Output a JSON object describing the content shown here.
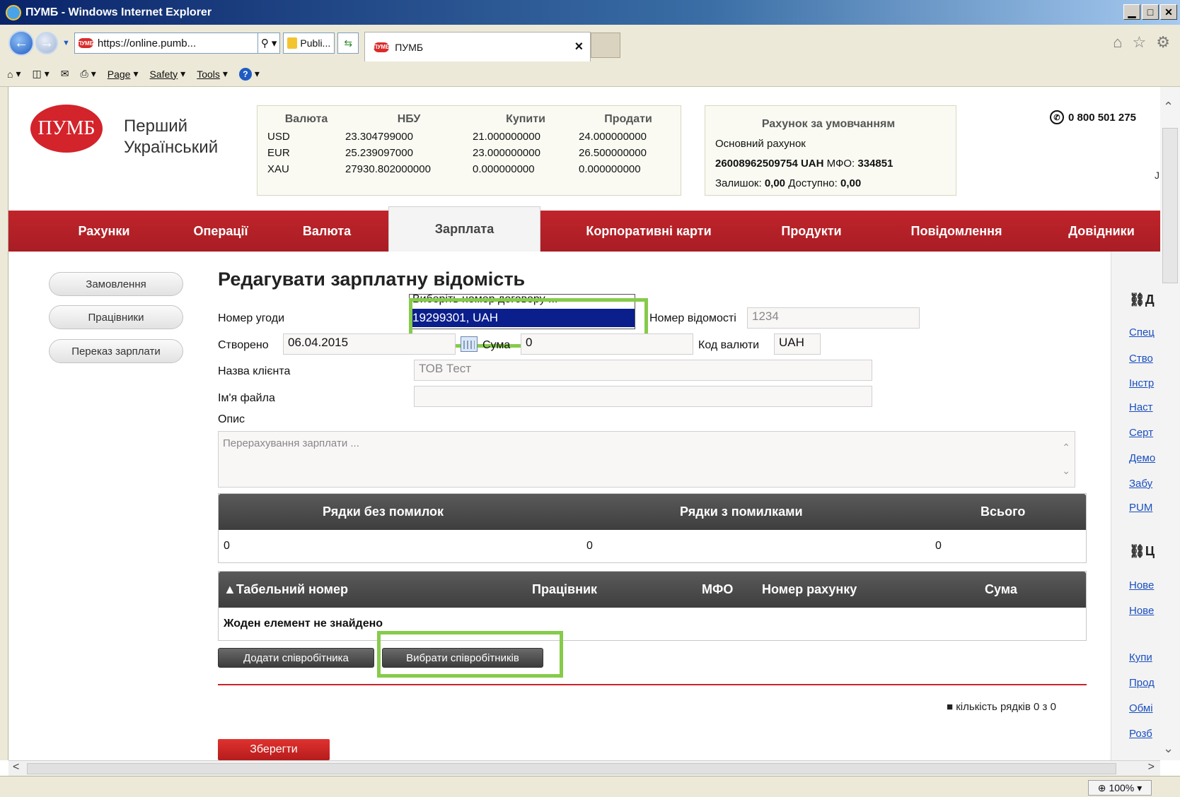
{
  "browser": {
    "window_title": "ПУМБ - Windows Internet Explorer",
    "url": "https://online.pumb...",
    "security_label": "Publi...",
    "tab_title": "ПУМБ",
    "favicon_text": "ПУМБ",
    "menu": {
      "page": "Page",
      "safety": "Safety",
      "tools": "Tools"
    },
    "zoom": "100%"
  },
  "header": {
    "logo_text": "ПУМБ",
    "bank_name_line1": "Перший",
    "bank_name_line2": "Український",
    "phone": "0 800 501 275",
    "stray_char": "J"
  },
  "rates": {
    "headers": [
      "Валюта",
      "НБУ",
      "Купити",
      "Продати"
    ],
    "rows": [
      [
        "USD",
        "23.304799000",
        "21.000000000",
        "24.000000000"
      ],
      [
        "EUR",
        "25.239097000",
        "23.000000000",
        "26.500000000"
      ],
      [
        "XAU",
        "27930.802000000",
        "0.000000000",
        "0.000000000"
      ]
    ]
  },
  "default_account": {
    "title": "Рахунок за умовчанням",
    "name": "Основний рахунок",
    "number": "26008962509754 UAH",
    "mfo_label": "МФО:",
    "mfo": "334851",
    "balance_label": "Залишок:",
    "balance": "0,00",
    "available_label": "Доступно:",
    "available": "0,00"
  },
  "main_menu": [
    "Рахунки",
    "Операції",
    "Валюта",
    "Зарплата",
    "Корпоративні карти",
    "Продукти",
    "Повідомлення",
    "Довідники"
  ],
  "main_menu_active": "Зарплата",
  "sidebar": [
    "Замовлення",
    "Працівники",
    "Переказ зарплати"
  ],
  "form": {
    "title": "Редагувати зарплатну відомість",
    "contract_label": "Номер угоди",
    "contract_options": [
      "Виберіть номер договору ...",
      "19299301, UAH"
    ],
    "statement_label": "Номер відомості",
    "statement_value": "1234",
    "created_label": "Створено",
    "created_value": "06.04.2015",
    "sum_label": "Сума",
    "sum_value": "0",
    "currency_label": "Код валюти",
    "currency_value": "UAH",
    "client_label": "Назва клієнта",
    "client_value": "ТОВ Тест",
    "file_label": "Ім'я файла",
    "file_value": "",
    "desc_label": "Опис",
    "desc_placeholder": "Перерахування зарплати ..."
  },
  "summary_table": {
    "headers": [
      "Рядки без помилок",
      "Рядки з помилками",
      "Всього"
    ],
    "values": [
      "0",
      "0",
      "0"
    ]
  },
  "employees_table": {
    "headers": [
      "▲Табельний номер",
      "Працівник",
      "МФО",
      "Номер рахунку",
      "Сума"
    ],
    "empty_text": "Жоден елемент не знайдено"
  },
  "buttons": {
    "add_employee": "Додати співробітника",
    "select_employees": "Вибрати співробітників",
    "save": "Зберегти"
  },
  "rows_count": "■ кількість рядків 0 з 0",
  "right_column": {
    "head1": "Д",
    "links1": [
      "Спец",
      "Ство",
      "Інстр",
      "Наст",
      "Серт",
      "Демо",
      "Забу",
      "PUM"
    ],
    "head2": "Ц",
    "links2": [
      "Нове",
      "Нове"
    ],
    "links3": [
      "Купи",
      "Прод",
      "Обмі",
      "Розб"
    ]
  }
}
